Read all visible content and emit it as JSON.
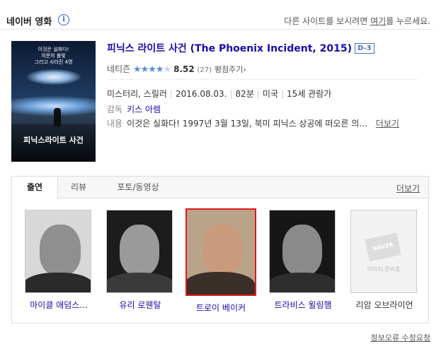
{
  "header": {
    "title": "네이버 영화",
    "info_icon": "i",
    "notice_prefix": "다른 사이트를 보시려면 ",
    "notice_link": "여기",
    "notice_suffix": "를 누르세요."
  },
  "movie": {
    "title": "피닉스 라이트 사건 (The Phoenix Incident, 2015)",
    "badge": "D-3",
    "rating_label": "네티즌",
    "rating_value": 4.26,
    "score": "8.52",
    "votes": "(27)",
    "rate_link": "평점주기",
    "genre": "미스터리, 스릴러",
    "release": "2016.08.03.",
    "runtime": "82분",
    "country": "미국",
    "age": "15세 관람가",
    "director_label": "감독",
    "director": "키스 아렘",
    "synopsis_label": "내용",
    "synopsis": "이것은 실화다! 1997년 3월 13일, 북미 피닉스 상공에 떠오른 의...",
    "more": "더보기",
    "poster": {
      "tagline_1": "이것은 실화다!",
      "tagline_2": "의문의 불빛",
      "tagline_3": "그리고 사라진 4명",
      "title_text": "피닉스라이트 사건"
    }
  },
  "tabs": {
    "items": [
      "출연",
      "리뷰",
      "포토/동영상"
    ],
    "active": "출연",
    "more": "더보기"
  },
  "cast": [
    {
      "name": "마이클 애덤스...",
      "selected": false
    },
    {
      "name": "유리 로웬탈",
      "selected": false
    },
    {
      "name": "트로이 베이커",
      "selected": true
    },
    {
      "name": "트라비스 윌링햄",
      "selected": false
    },
    {
      "name": "리암 오브라이언",
      "selected": false,
      "no_image": true,
      "placeholder_logo": "NAVER",
      "placeholder_text": "이미지 준비중"
    }
  ],
  "footer": {
    "report_link": "정보오류 수정요청"
  }
}
